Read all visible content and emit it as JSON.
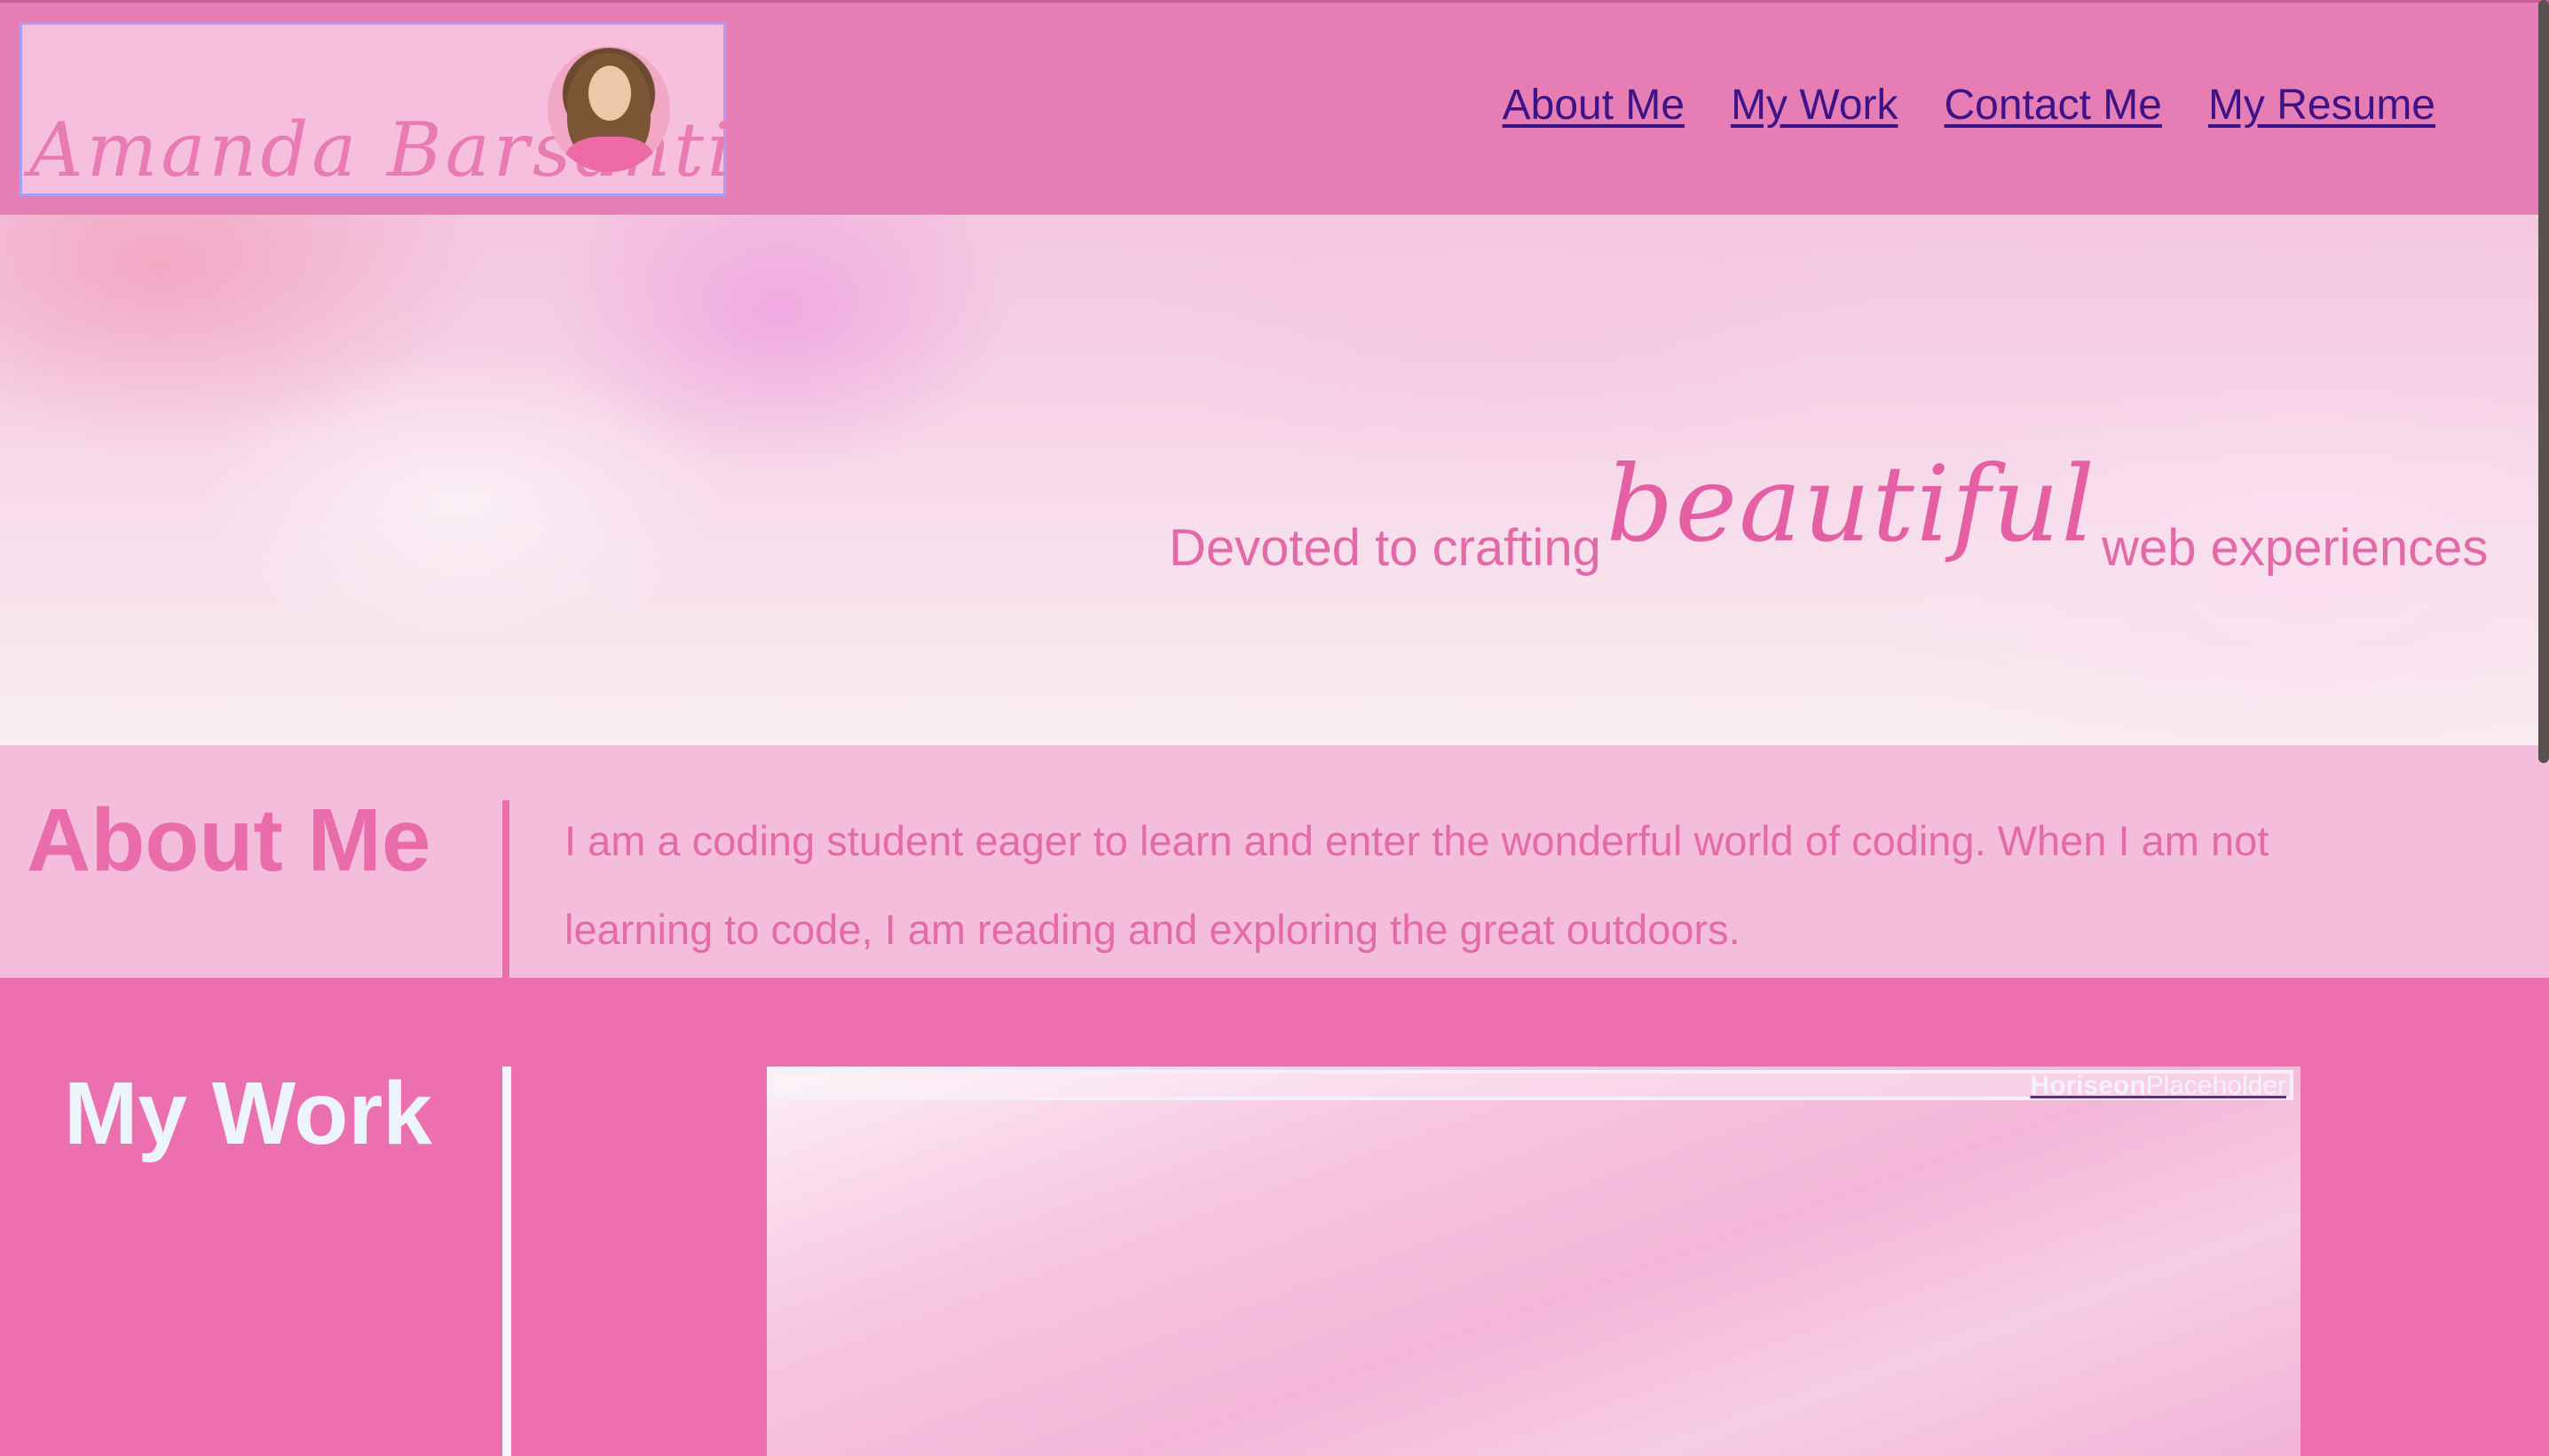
{
  "header": {
    "brand_name": "Amanda Barsanti",
    "nav": [
      {
        "label": "About Me"
      },
      {
        "label": "My Work"
      },
      {
        "label": "Contact Me"
      },
      {
        "label": "My Resume"
      }
    ]
  },
  "hero": {
    "tagline_start": "Devoted to crafting",
    "tagline_emphasis": "beautiful",
    "tagline_end": "web experiences"
  },
  "about": {
    "title": "About Me",
    "text": "I am a coding student eager to learn and enter the wonderful world of coding. When I am not learning to code, I am reading and exploring the great outdoors."
  },
  "work": {
    "title": "My Work",
    "project_label_bold": "Horiseon",
    "project_label_plain": "Placeholder"
  },
  "colors": {
    "header_bg": "#e67db4",
    "brand_bg": "#f5bfdd",
    "brand_border": "#a9a2f3",
    "link": "#3d1487",
    "about_bg": "#f5bddc",
    "work_bg": "#ec6fb0",
    "accent_pink": "#ea6dab"
  }
}
